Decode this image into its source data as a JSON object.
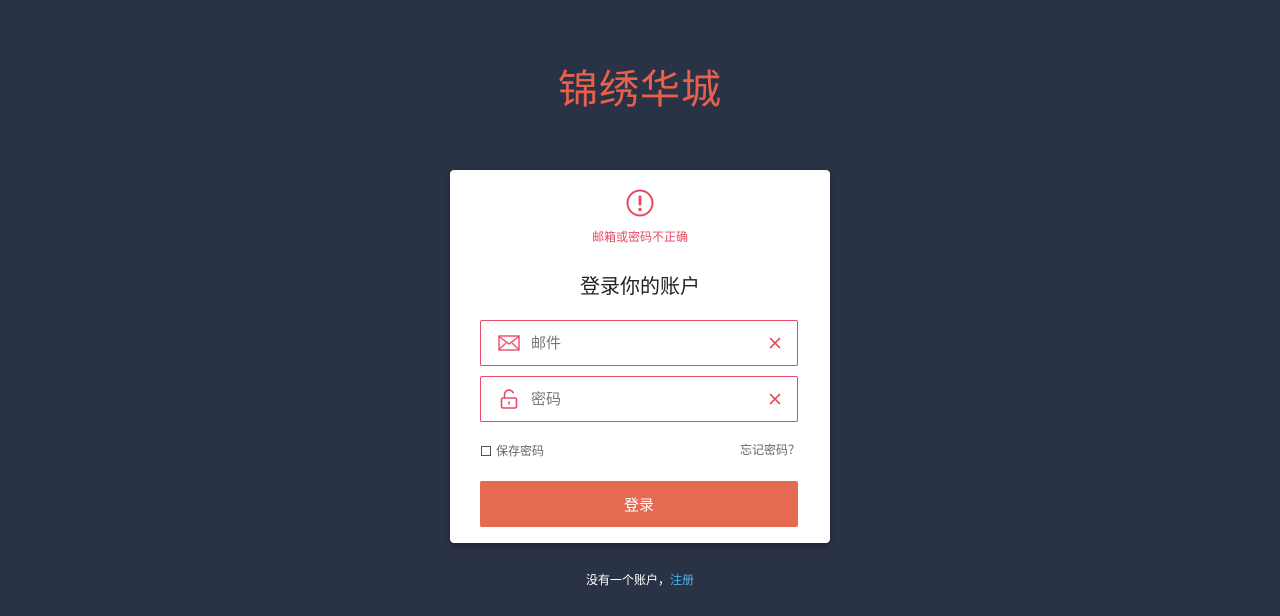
{
  "brand": {
    "title": "锦绣华城"
  },
  "login": {
    "alert_icon": "exclamation-circle-icon",
    "alert_text": "邮箱或密码不正确",
    "title": "登录你的账户",
    "email": {
      "placeholder": "邮件",
      "value": "",
      "icon": "envelope-icon"
    },
    "password": {
      "placeholder": "密码",
      "value": "",
      "icon": "unlock-icon"
    },
    "remember_label": "保存密码",
    "forgot_label": "忘记密码？",
    "submit_label": "登录"
  },
  "footer": {
    "prompt": "没有一个账户，",
    "register_label": "注册"
  },
  "colors": {
    "background": "#2a3245",
    "brand": "#e8604c",
    "error": "#e84a5f",
    "button": "#e56a52",
    "link": "#4fb0e8"
  }
}
